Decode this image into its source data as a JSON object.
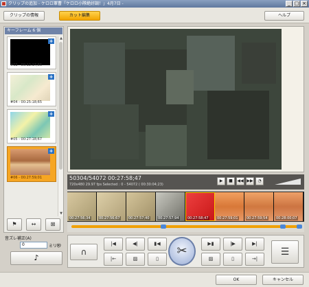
{
  "window": {
    "title": "クリップの追加 - ケロロ軍曹「ケロロ小隊絶好調！」4月7日 -"
  },
  "toolbar": {
    "tabs": [
      {
        "label": "クリップの情報",
        "active": false
      },
      {
        "label": "カット編集",
        "active": true
      }
    ],
    "help_label": "ヘルプ"
  },
  "keyframes": {
    "header": "キーフレーム 6 個",
    "items": [
      {
        "label": "#03 - 00:13:17;66",
        "selected": false
      },
      {
        "label": "#04 - 00:25:18;65",
        "selected": false
      },
      {
        "label": "#05 - 00:27:18;67",
        "selected": false
      },
      {
        "label": "#06 - 00:27:59;01",
        "selected": true
      }
    ],
    "tools": [
      "flag-icon",
      "split-icon",
      "delete-icon"
    ]
  },
  "status": {
    "time_main": "50304/54072  00:27:58;47",
    "time_sub": "720x480 29.97 fps   Selected : 0 - 54072 ( 00:30:04;23)"
  },
  "timeline": {
    "frames": [
      {
        "label": "00:27:56;34"
      },
      {
        "label": "00:27:56;67"
      },
      {
        "label": "00:27:57;40"
      },
      {
        "label": "00:27:57;94"
      },
      {
        "label": "00:27:58;47"
      },
      {
        "label": "00:27:59;01"
      },
      {
        "label": "00:27:59;54"
      },
      {
        "label": "00:28:00;07"
      }
    ]
  },
  "sync": {
    "label": "音ズレ補正(A)",
    "value": "0",
    "unit": "ミリ秒"
  },
  "footer": {
    "ok": "OK",
    "cancel": "キャンセル"
  }
}
